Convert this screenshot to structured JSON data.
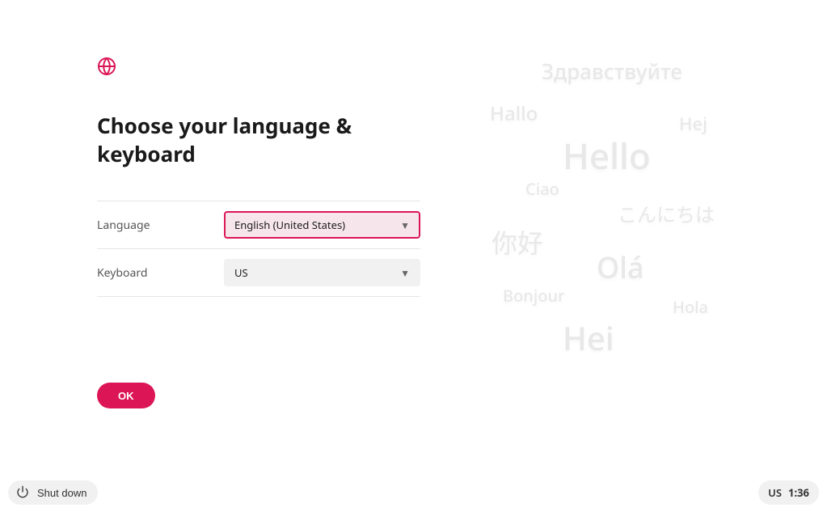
{
  "colors": {
    "accent": "#dc1656"
  },
  "heading": "Choose your language & keyboard",
  "fields": {
    "language": {
      "label": "Language",
      "value": "English (United States)"
    },
    "keyboard": {
      "label": "Keyboard",
      "value": "US"
    }
  },
  "buttons": {
    "ok": "OK",
    "shutdown": "Shut down"
  },
  "status": {
    "keyboard_indicator": "US",
    "time": "1:36"
  },
  "greetings": [
    "Здравствуйте",
    "Hallo",
    "Hej",
    "Hello",
    "Ciao",
    "こんにちは",
    "你好",
    "Olá",
    "Bonjour",
    "Hola",
    "Hei"
  ]
}
